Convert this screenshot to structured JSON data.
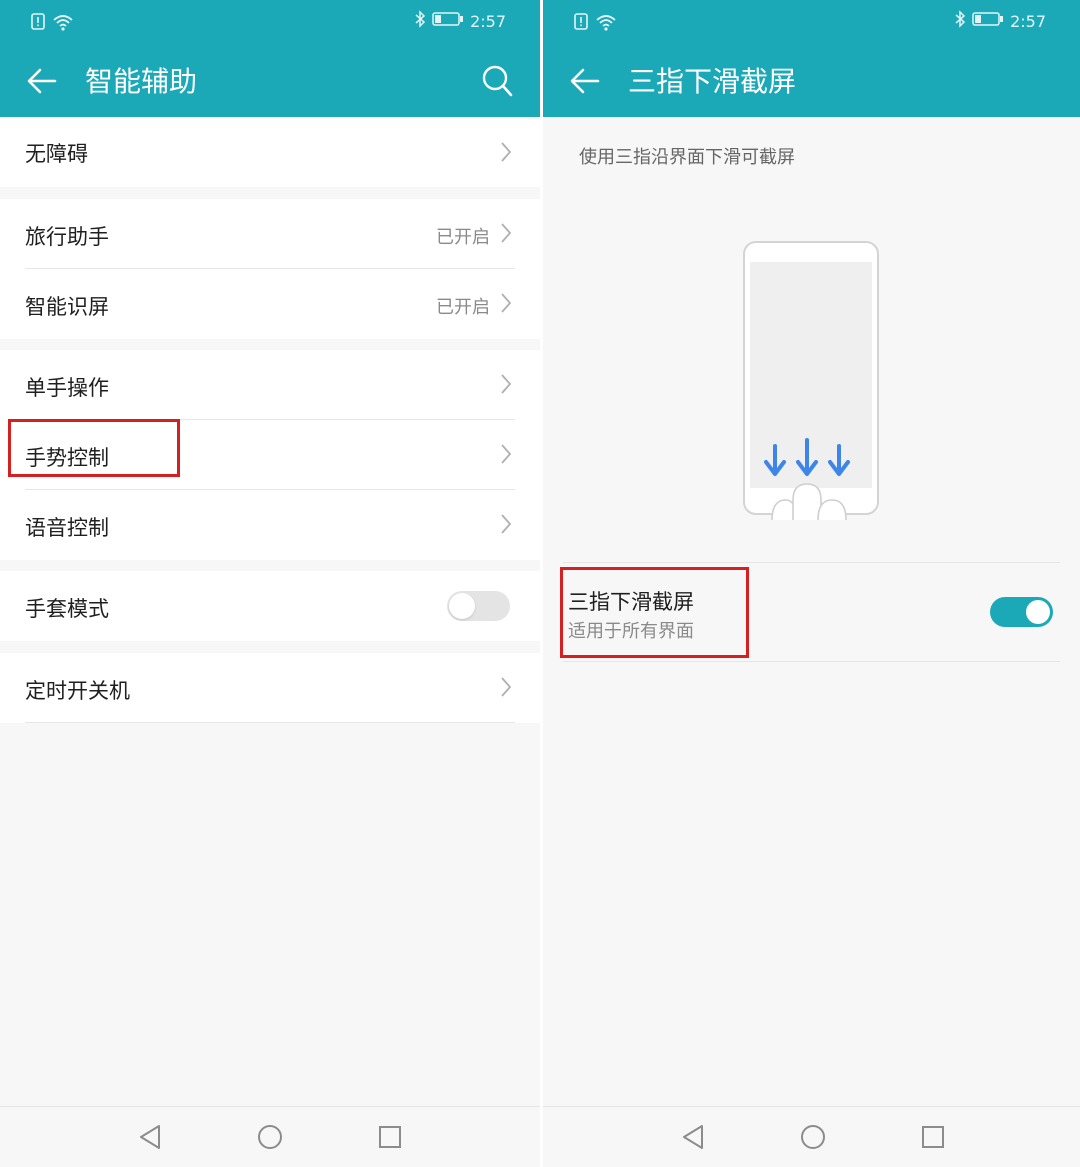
{
  "status": {
    "time": "2:57"
  },
  "left": {
    "title": "智能辅助",
    "items": [
      {
        "label": "无障碍",
        "status": ""
      },
      {
        "label": "旅行助手",
        "status": "已开启"
      },
      {
        "label": "智能识屏",
        "status": "已开启"
      },
      {
        "label": "单手操作",
        "status": ""
      },
      {
        "label": "手势控制",
        "status": ""
      },
      {
        "label": "语音控制",
        "status": ""
      },
      {
        "label": "手套模式",
        "status": ""
      },
      {
        "label": "定时开关机",
        "status": ""
      }
    ],
    "glove_mode_enabled": false
  },
  "right": {
    "title": "三指下滑截屏",
    "description": "使用三指沿界面下滑可截屏",
    "setting": {
      "title": "三指下滑截屏",
      "subtitle": "适用于所有界面",
      "enabled": true
    }
  },
  "colors": {
    "accent": "#1ba9b8",
    "highlight": "#d42020",
    "background": "#f7f7f7"
  }
}
